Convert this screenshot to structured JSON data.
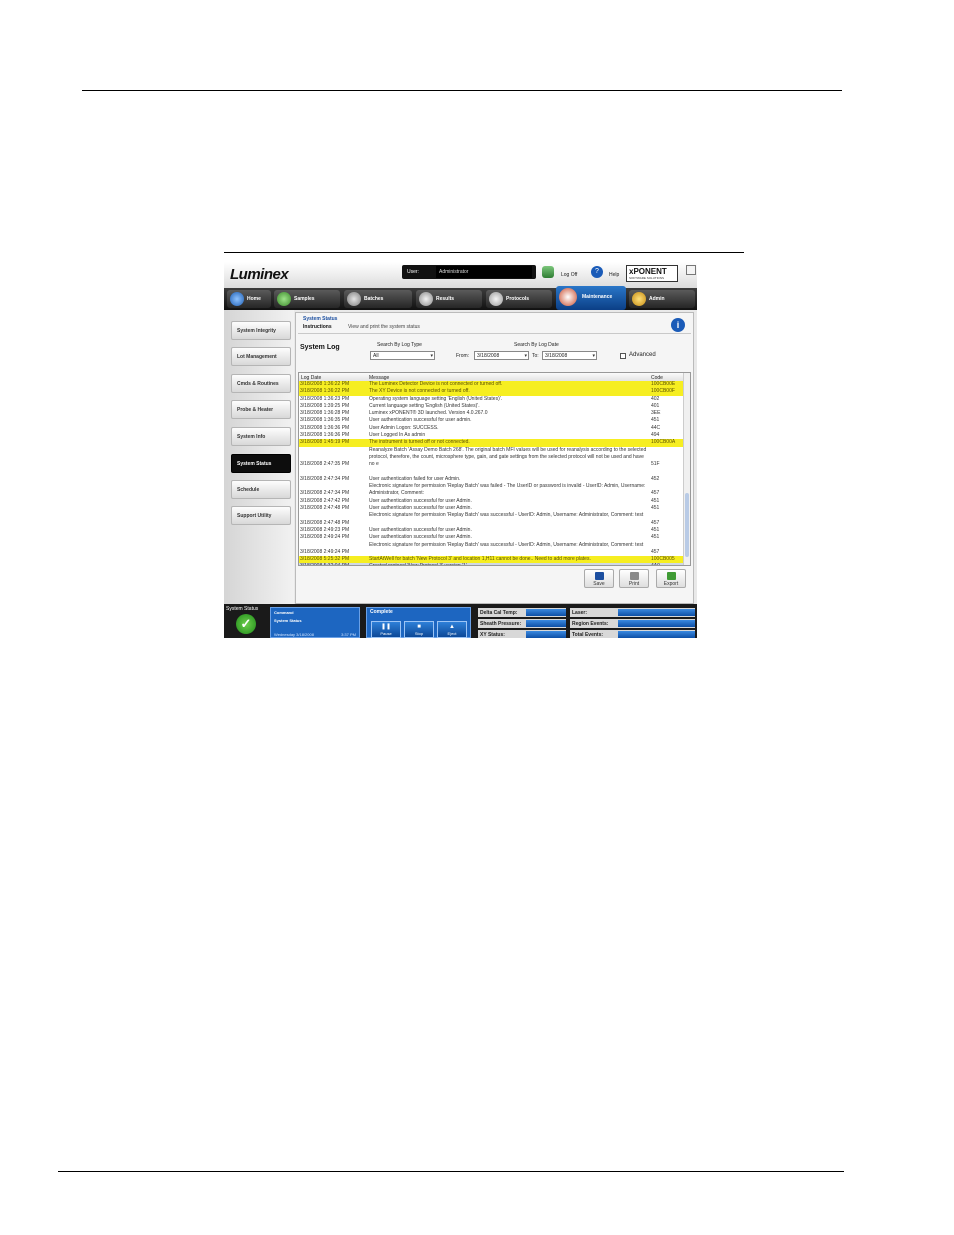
{
  "header": {
    "logo": "Luminex",
    "user_label": "User:",
    "user_value": "Administrator",
    "logoff_label": "Log Off",
    "help_label": "Help",
    "brand_main": "xPONENT",
    "brand_sub": "SOFTWARE SOLUTIONS"
  },
  "nav": {
    "tabs": [
      {
        "label": "Home"
      },
      {
        "label": "Samples"
      },
      {
        "label": "Batches"
      },
      {
        "label": "Results"
      },
      {
        "label": "Protocols"
      },
      {
        "label": "Maintenance"
      },
      {
        "label": "Admin"
      }
    ],
    "active": "Maintenance"
  },
  "sidebar": {
    "items": [
      {
        "label": "System Integrity"
      },
      {
        "label": "Lot Management"
      },
      {
        "label": "Cmds & Routines"
      },
      {
        "label": "Probe & Heater"
      },
      {
        "label": "System Info"
      },
      {
        "label": "System Status"
      },
      {
        "label": "Schedule"
      },
      {
        "label": "Support Utility"
      }
    ],
    "active": "System Status"
  },
  "main": {
    "section_title": "System Status",
    "instructions_label": "Instructions",
    "instructions_text": "View and print the system status",
    "panel_title": "System Log",
    "search_type_label": "Search By Log Type",
    "search_type_value": "All",
    "search_date_label": "Search By Log Date",
    "from_label": "From:",
    "from_value": "3/18/2008",
    "to_label": "To:",
    "to_value": "3/18/2008",
    "advanced_label": "Advanced",
    "columns": {
      "date": "Log Date",
      "message": "Message",
      "code": "Code"
    },
    "rows": [
      {
        "date": "3/18/2008 1:36:22 PM",
        "message": "The Luminex Detector Device is not connected or turned off.",
        "code": "100CB00E",
        "hl": true,
        "lines": 1
      },
      {
        "date": "3/18/2008 1:36:22 PM",
        "message": "The XY Device is not connected or turned off.",
        "code": "100CB00F",
        "hl": true,
        "lines": 1
      },
      {
        "date": "3/18/2008 1:36:23 PM",
        "message": "Operating system language setting 'English (United States)'.",
        "code": "402",
        "hl": false,
        "lines": 1
      },
      {
        "date": "3/18/2008 1:39:25 PM",
        "message": "Current language setting 'English (United States)'.",
        "code": "401",
        "hl": false,
        "lines": 1
      },
      {
        "date": "3/18/2008 1:36:28 PM",
        "message": "Luminex xPONENT® 3D launched. Version 4.0.267.0",
        "code": "3EE",
        "hl": false,
        "lines": 1
      },
      {
        "date": "3/18/2008 1:36:35 PM",
        "message": "User authentication successful for user admin.",
        "code": "451",
        "hl": false,
        "lines": 1
      },
      {
        "date": "3/18/2008 1:36:36 PM",
        "message": "User Admin Logon: SUCCESS.",
        "code": "44C",
        "hl": false,
        "lines": 1
      },
      {
        "date": "3/18/2008 1:36:36 PM",
        "message": "User Logged In As admin",
        "code": "494",
        "hl": false,
        "lines": 1
      },
      {
        "date": "3/18/2008 1:45:19 PM",
        "message": "The instrument is turned off or not connected.",
        "code": "100CB00A",
        "hl": true,
        "lines": 1
      },
      {
        "date": "3/18/2008 2:47:35 PM",
        "message": "Reanalyze Batch 'Assay Demo Batch 268'. The original batch MFI values will be used for reanalysis according to the selected protocol, therefore, the count, microsphere type, gain, and gate settings from the selected protocol will not be used and have no e",
        "code": "51F",
        "hl": false,
        "lines": 4
      },
      {
        "date": "3/18/2008 2:47:34 PM",
        "message": "User authentication failed for user Admin.",
        "code": "452",
        "hl": false,
        "lines": 1
      },
      {
        "date": "3/18/2008 2:47:34 PM",
        "message": "Electronic signature for permission 'Replay Batch' was failed - The UserID or password is invalid - UserID: Admin, Username: Administrator, Comment:",
        "code": "457",
        "hl": false,
        "lines": 2
      },
      {
        "date": "3/18/2008 2:47:42 PM",
        "message": "User authentication successful for user Admin.",
        "code": "451",
        "hl": false,
        "lines": 1
      },
      {
        "date": "3/18/2008 2:47:48 PM",
        "message": "User authentication successful for user Admin.",
        "code": "451",
        "hl": false,
        "lines": 1
      },
      {
        "date": "3/18/2008 2:47:48 PM",
        "message": "Electronic signature for permission 'Replay Batch' was successful - UserID: Admin, Username: Administrator, Comment: test",
        "code": "457",
        "hl": false,
        "lines": 2
      },
      {
        "date": "3/18/2008 2:49:23 PM",
        "message": "User authentication successful for user Admin.",
        "code": "451",
        "hl": false,
        "lines": 1
      },
      {
        "date": "3/18/2008 2:49:24 PM",
        "message": "User authentication successful for user Admin.",
        "code": "451",
        "hl": false,
        "lines": 1
      },
      {
        "date": "3/18/2008 2:49:24 PM",
        "message": "Electronic signature for permission 'Replay Batch' was successful - UserID: Admin, Username: Administrator, Comment: test",
        "code": "457",
        "hl": false,
        "lines": 2
      },
      {
        "date": "3/18/2008 5:25:32 PM",
        "message": "StartAtWell for batch 'New Protocol 3' and location 1,H11 cannot be done.. Need to add more plates.",
        "code": "100CB005",
        "hl": true,
        "lines": 1
      },
      {
        "date": "3/18/2008 5:32:04 PM",
        "message": "Created protocol 'New Protocol 3' version '1'.",
        "code": "4A0",
        "hl": false,
        "lines": 1,
        "selected": true
      }
    ],
    "buttons": {
      "save": "Save",
      "print": "Print",
      "export": "Export"
    }
  },
  "statusbar": {
    "system_status_label": "System Status",
    "command_label": "Command",
    "command_value": "System Status",
    "command_date": "Wednesday 3/18/2008",
    "command_time": "3:37 PM",
    "complete_label": "Complete",
    "pause": "Pause",
    "stop": "Stop",
    "eject": "Eject",
    "meters": {
      "delta": "Delta Cal Temp:",
      "sheath": "Sheath Pressure:",
      "xy": "XY Status:",
      "laser": "Laser:",
      "region": "Region Events:",
      "total": "Total Events:"
    }
  },
  "colors": {
    "accent": "#1d66c1",
    "highlight": "#f6ee21",
    "nav_dark": "#1a1a1a"
  }
}
